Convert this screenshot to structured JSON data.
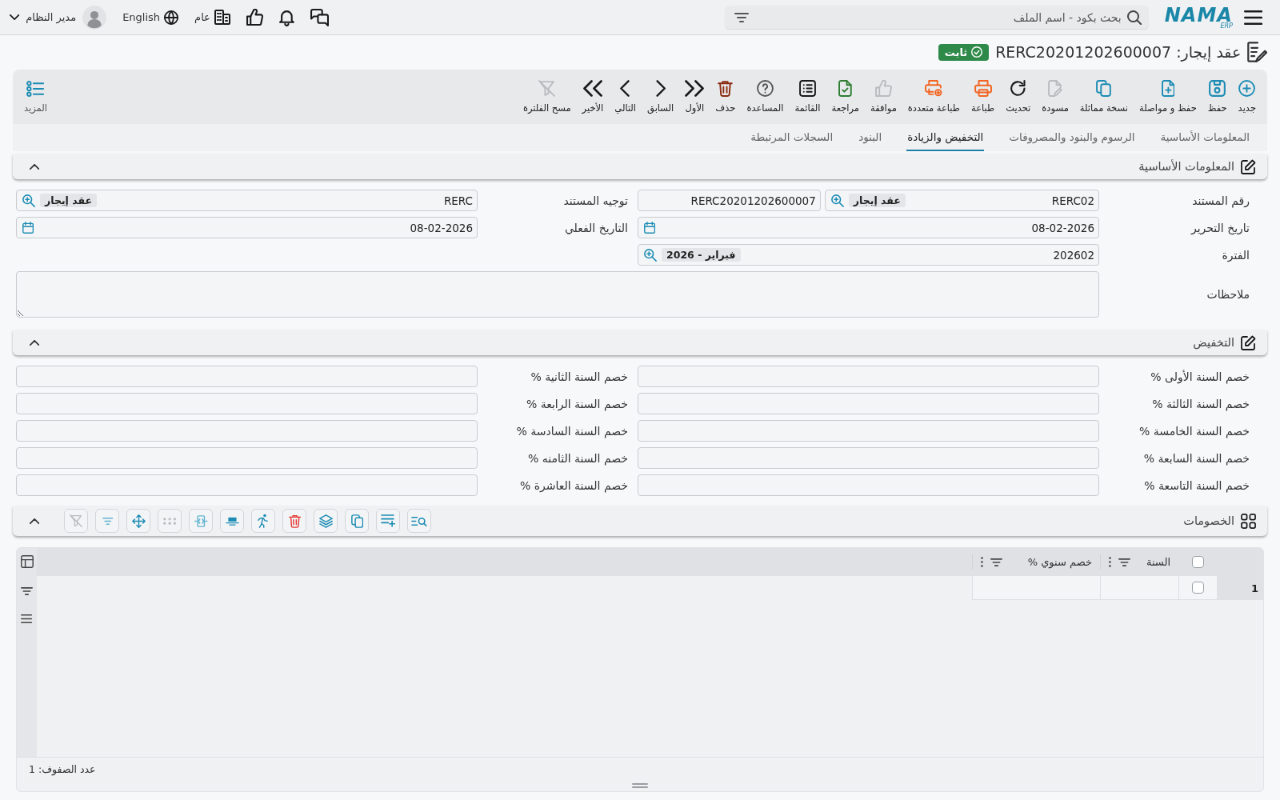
{
  "top_bar": {
    "logo": {
      "name": "NAMA",
      "sub": "ERP"
    },
    "search": {
      "placeholder": "بحث بكود - اسم الملف"
    },
    "company": "عام",
    "language": "English",
    "user": "مدير النظام"
  },
  "title": {
    "text": "عقد إيجار: RERC20201202600007",
    "status": "ثابت"
  },
  "toolbar": {
    "buttons": [
      {
        "label": "جديد",
        "kind": "new",
        "disabled": false
      },
      {
        "label": "حفظ",
        "kind": "save",
        "disabled": false
      },
      {
        "label": "حفظ و مواصلة",
        "kind": "save-continue",
        "disabled": false
      },
      {
        "label": "نسخة مماثلة",
        "kind": "duplicate",
        "disabled": false
      },
      {
        "label": "مسودة",
        "kind": "draft",
        "disabled": true
      },
      {
        "label": "تحديث",
        "kind": "refresh",
        "disabled": false
      },
      {
        "label": "طباعة",
        "kind": "print",
        "disabled": false
      },
      {
        "label": "طباعة متعددة",
        "kind": "multi-print",
        "disabled": false
      },
      {
        "label": "موافقة",
        "kind": "approve",
        "disabled": true
      },
      {
        "label": "مراجعة",
        "kind": "review",
        "disabled": false
      },
      {
        "label": "القائمة",
        "kind": "list",
        "disabled": false
      },
      {
        "label": "المساعدة",
        "kind": "help",
        "disabled": false
      },
      {
        "label": "حذف",
        "kind": "delete",
        "disabled": false
      },
      {
        "label": "الأول",
        "kind": "first",
        "disabled": false
      },
      {
        "label": "السابق",
        "kind": "previous",
        "disabled": false
      },
      {
        "label": "التالي",
        "kind": "next",
        "disabled": false
      },
      {
        "label": "الأخير",
        "kind": "last",
        "disabled": false
      },
      {
        "label": "مسح الفلترة",
        "kind": "clear-filter",
        "disabled": true
      }
    ],
    "more": "المزيد"
  },
  "tabs": [
    {
      "label": "المعلومات الأساسية",
      "selected": false
    },
    {
      "label": "الرسوم والبنود والمصروفات",
      "selected": false
    },
    {
      "label": "التخفيض والزيادة",
      "selected": true
    },
    {
      "label": "البنود",
      "selected": false
    },
    {
      "label": "السجلات المرتبطة",
      "selected": false
    }
  ],
  "sections": [
    {
      "kind": "form",
      "title": "المعلومات الأساسية",
      "expanded": true,
      "fields": [
        {
          "label": "رقم المستند",
          "inputs": [
            {
              "kind": "lookup",
              "value": "RERC02",
              "chip": "عقد إيجار"
            },
            {
              "kind": "text",
              "value": "RERC20201202600007"
            }
          ]
        },
        {
          "label": "توجيه المستند",
          "inputs": [
            {
              "kind": "lookup",
              "value": "RERC",
              "chip": "عقد إيجار"
            }
          ]
        },
        {
          "label": "تاريخ التحرير",
          "inputs": [
            {
              "kind": "date",
              "value": "08-02-2026"
            }
          ]
        },
        {
          "label": "التاريخ الفعلي",
          "inputs": [
            {
              "kind": "date",
              "value": "08-02-2026"
            }
          ]
        },
        {
          "label": "الفترة",
          "inputs": [
            {
              "kind": "lookup",
              "value": "202602",
              "chip": "فبراير - 2026"
            }
          ]
        },
        {
          "label": "ملاحظات",
          "inputs": [
            {
              "kind": "textarea"
            }
          ]
        }
      ]
    },
    {
      "kind": "form",
      "title": "التخفيض",
      "expanded": true,
      "fields": [
        {
          "label": "خصم السنة الأولى %",
          "inputs": [
            {
              "kind": "text"
            }
          ]
        },
        {
          "label": "خصم السنة الثانية %",
          "inputs": [
            {
              "kind": "text"
            }
          ]
        },
        {
          "label": "خصم السنة الثالثة %",
          "inputs": [
            {
              "kind": "text"
            }
          ]
        },
        {
          "label": "خصم السنة الرابعة %",
          "inputs": [
            {
              "kind": "text"
            }
          ]
        },
        {
          "label": "خصم السنة الخامسة %",
          "inputs": [
            {
              "kind": "text"
            }
          ]
        },
        {
          "label": "خصم السنة السادسة %",
          "inputs": [
            {
              "kind": "text"
            }
          ]
        },
        {
          "label": "خصم السنة السابعة %",
          "inputs": [
            {
              "kind": "text"
            }
          ]
        },
        {
          "label": "خصم السنة الثامنه %",
          "inputs": [
            {
              "kind": "text"
            }
          ]
        },
        {
          "label": "خصم السنة التاسعة %",
          "inputs": [
            {
              "kind": "text"
            }
          ]
        },
        {
          "label": "خصم السنة العاشرة %",
          "inputs": [
            {
              "kind": "text"
            }
          ]
        }
      ]
    },
    {
      "kind": "grid",
      "title": "الخصومات",
      "expanded": true,
      "tools": [
        {
          "kind": "search-list",
          "disabled": false
        },
        {
          "kind": "add-row",
          "disabled": false
        },
        {
          "kind": "copy",
          "disabled": false
        },
        {
          "kind": "layers",
          "disabled": false
        },
        {
          "kind": "delete",
          "disabled": false
        },
        {
          "kind": "runner",
          "disabled": false
        },
        {
          "kind": "table-row",
          "disabled": false
        },
        {
          "kind": "fit-columns",
          "disabled": false
        },
        {
          "kind": "dots",
          "disabled": true
        },
        {
          "kind": "move",
          "disabled": false
        },
        {
          "kind": "filter",
          "disabled": false
        },
        {
          "kind": "clear-filter",
          "disabled": true
        }
      ],
      "grid": {
        "columns": [
          "السنة",
          "خصم سنوي %"
        ],
        "all_checked": false,
        "rows": [
          {
            "number": "1",
            "checked": false
          }
        ],
        "footer": "عدد الصفوف: 1"
      }
    }
  ]
}
